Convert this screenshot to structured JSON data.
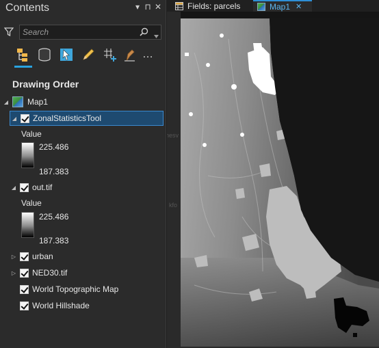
{
  "contents": {
    "title": "Contents",
    "controls": {
      "menu": "▾",
      "pin": "⊓",
      "close": "✕"
    },
    "search": {
      "placeholder": "Search",
      "value": ""
    },
    "toolbar": {
      "icons": [
        "list-by-drawing-order-icon",
        "list-by-data-source-icon",
        "list-by-selection-icon",
        "list-by-editing-icon",
        "list-by-snapping-icon",
        "list-by-labeling-icon",
        "more-icon"
      ],
      "more_label": "…"
    },
    "heading": "Drawing Order",
    "map_name": "Map1",
    "layers": [
      {
        "name": "ZonalStatisticsTool",
        "checked": true,
        "expanded": true,
        "selected": true,
        "legend_title": "Value",
        "max": "225.486",
        "min": "187.383"
      },
      {
        "name": "out.tif",
        "checked": true,
        "expanded": true,
        "selected": false,
        "legend_title": "Value",
        "max": "225.486",
        "min": "187.383"
      },
      {
        "name": "urban",
        "checked": true,
        "expanded": false
      },
      {
        "name": "NED30.tif",
        "checked": true,
        "expanded": false
      },
      {
        "name": "World Topographic Map",
        "checked": true,
        "expandable": false
      },
      {
        "name": "World Hillshade",
        "checked": true,
        "expandable": false
      }
    ]
  },
  "tabs": [
    {
      "label": "Fields:  parcels",
      "active": false
    },
    {
      "label": "Map1",
      "active": true,
      "close": "✕"
    }
  ],
  "map": {
    "labels": [
      "nesv",
      "kfo"
    ]
  },
  "colors": {
    "accent": "#29a3e0",
    "selection": "#1e4a70",
    "tab_active_text": "#5db6f0"
  }
}
